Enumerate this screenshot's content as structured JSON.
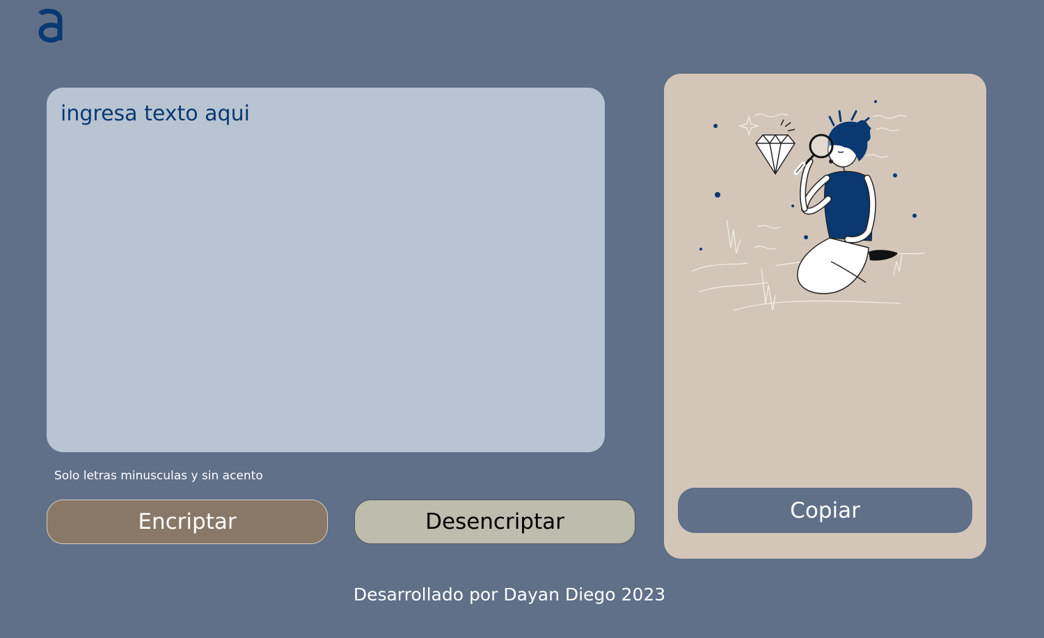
{
  "logo": {
    "letter": "a",
    "color": "#0a3871"
  },
  "input": {
    "placeholder": "ingresa texto aqui",
    "value": ""
  },
  "hint": "Solo letras minusculas y sin acento",
  "buttons": {
    "encrypt_label": "Encriptar",
    "decrypt_label": "Desencriptar",
    "copy_label": "Copiar"
  },
  "footer": "Desarrollado por Dayan Diego 2023",
  "illustration": {
    "name": "person-inspecting-diamond-with-magnifier"
  },
  "colors": {
    "background": "#5f7088",
    "input_panel": "#b8c4d1",
    "text_accent": "#0a3871",
    "output_panel": "#d3c6b9",
    "encrypt_button": "#897867",
    "decrypt_button": "#bdbcad"
  }
}
